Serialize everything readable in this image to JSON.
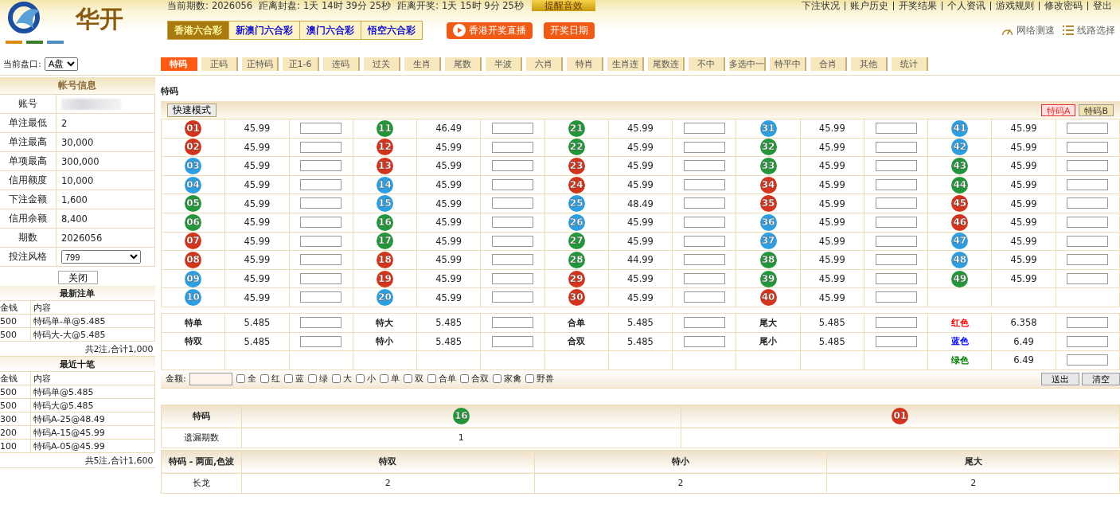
{
  "header": {
    "logo_text": "华开",
    "period_label": "当前期数:",
    "period": "2026056",
    "close_label": "距离封盘:",
    "close_time": "1天 14时 39分 25秒",
    "draw_label": "距离开奖:",
    "draw_time": "1天 15时 9分 25秒",
    "sound_button": "提醒音效",
    "user_links": [
      "下注状况",
      "账户历史",
      "开奖结果",
      "个人资讯",
      "游戏规则",
      "修改密码",
      "登出"
    ],
    "lottery_tabs": [
      {
        "label": "香港六合彩",
        "selected": true
      },
      {
        "label": "新澳门六合彩",
        "selected": false
      },
      {
        "label": "澳门六合彩",
        "selected": false
      },
      {
        "label": "悟空六合彩",
        "selected": false
      }
    ],
    "live_button": "香港开奖直播",
    "date_button": "开奖日期",
    "speed_test": "网络测速",
    "line_select": "线路选择"
  },
  "market": {
    "label": "当前盘口:",
    "value": "A盘"
  },
  "game_tabs": [
    {
      "label": "特码",
      "selected": true
    },
    {
      "label": "正码",
      "selected": false
    },
    {
      "label": "正特码",
      "selected": false
    },
    {
      "label": "正1-6",
      "selected": false
    },
    {
      "label": "连码",
      "selected": false
    },
    {
      "label": "过关",
      "selected": false
    },
    {
      "label": "生肖",
      "selected": false
    },
    {
      "label": "尾数",
      "selected": false
    },
    {
      "label": "半波",
      "selected": false
    },
    {
      "label": "六肖",
      "selected": false
    },
    {
      "label": "特肖",
      "selected": false
    },
    {
      "label": "生肖连",
      "selected": false
    },
    {
      "label": "尾数连",
      "selected": false
    },
    {
      "label": "不中",
      "selected": false
    },
    {
      "label": "多选中一",
      "selected": false
    },
    {
      "label": "特平中",
      "selected": false
    },
    {
      "label": "合肖",
      "selected": false
    },
    {
      "label": "其他",
      "selected": false
    },
    {
      "label": "统计",
      "selected": false
    }
  ],
  "account": {
    "title": "帐号信息",
    "rows": [
      {
        "label": "账号",
        "kind": "redacted"
      },
      {
        "label": "单注最低",
        "value": "2"
      },
      {
        "label": "单注最高",
        "value": "30,000"
      },
      {
        "label": "单项最高",
        "value": "300,000"
      },
      {
        "label": "信用额度",
        "value": "10,000"
      },
      {
        "label": "下注金额",
        "value": "1,600"
      },
      {
        "label": "信用余额",
        "value": "8,400"
      },
      {
        "label": "期数",
        "value": "2026056"
      },
      {
        "label": "投注风格",
        "kind": "select",
        "value": "799"
      }
    ],
    "close_button": "关闭"
  },
  "bet_lists": [
    {
      "title": "最新注单",
      "columns": [
        "金钱",
        "内容"
      ],
      "rows": [
        [
          "500",
          "特码单-单@5.485"
        ],
        [
          "500",
          "特码大-大@5.485"
        ]
      ],
      "summary": "共2注,合计1,000"
    },
    {
      "title": "最近十笔",
      "columns": [
        "金钱",
        "内容"
      ],
      "rows": [
        [
          "500",
          "特码单@5.485"
        ],
        [
          "500",
          "特码大@5.485"
        ],
        [
          "300",
          "特码A-25@48.49"
        ],
        [
          "200",
          "特码A-15@45.99"
        ],
        [
          "100",
          "特码A-05@45.99"
        ]
      ],
      "summary": "共5注,合计1,600"
    }
  ],
  "main": {
    "section_title": "特码",
    "quick_mode_button": "快速模式",
    "variant_tabs": [
      {
        "label": "特码A",
        "selected": true
      },
      {
        "label": "特码B",
        "selected": false
      }
    ],
    "numbers": [
      {
        "number": "01",
        "color": "#d2341c",
        "odds": "45.99"
      },
      {
        "number": "02",
        "color": "#d2341c",
        "odds": "45.99"
      },
      {
        "number": "03",
        "color": "#2d9fe0",
        "odds": "45.99"
      },
      {
        "number": "04",
        "color": "#2d9fe0",
        "odds": "45.99"
      },
      {
        "number": "05",
        "color": "#24963a",
        "odds": "45.99"
      },
      {
        "number": "06",
        "color": "#24963a",
        "odds": "45.99"
      },
      {
        "number": "07",
        "color": "#d2341c",
        "odds": "45.99"
      },
      {
        "number": "08",
        "color": "#d2341c",
        "odds": "45.99"
      },
      {
        "number": "09",
        "color": "#2d9fe0",
        "odds": "45.99"
      },
      {
        "number": "10",
        "color": "#2d9fe0",
        "odds": "45.99"
      },
      {
        "number": "11",
        "color": "#24963a",
        "odds": "46.49"
      },
      {
        "number": "12",
        "color": "#d2341c",
        "odds": "45.99"
      },
      {
        "number": "13",
        "color": "#d2341c",
        "odds": "45.99"
      },
      {
        "number": "14",
        "color": "#2d9fe0",
        "odds": "45.99"
      },
      {
        "number": "15",
        "color": "#2d9fe0",
        "odds": "45.99"
      },
      {
        "number": "16",
        "color": "#24963a",
        "odds": "45.99"
      },
      {
        "number": "17",
        "color": "#24963a",
        "odds": "45.99"
      },
      {
        "number": "18",
        "color": "#d2341c",
        "odds": "45.99"
      },
      {
        "number": "19",
        "color": "#d2341c",
        "odds": "45.99"
      },
      {
        "number": "20",
        "color": "#2d9fe0",
        "odds": "45.99"
      },
      {
        "number": "21",
        "color": "#24963a",
        "odds": "45.99"
      },
      {
        "number": "22",
        "color": "#24963a",
        "odds": "45.99"
      },
      {
        "number": "23",
        "color": "#d2341c",
        "odds": "45.99"
      },
      {
        "number": "24",
        "color": "#d2341c",
        "odds": "45.99"
      },
      {
        "number": "25",
        "color": "#2d9fe0",
        "odds": "48.49"
      },
      {
        "number": "26",
        "color": "#2d9fe0",
        "odds": "45.99"
      },
      {
        "number": "27",
        "color": "#24963a",
        "odds": "45.99"
      },
      {
        "number": "28",
        "color": "#24963a",
        "odds": "44.99"
      },
      {
        "number": "29",
        "color": "#d2341c",
        "odds": "45.99"
      },
      {
        "number": "30",
        "color": "#d2341c",
        "odds": "45.99"
      },
      {
        "number": "31",
        "color": "#2d9fe0",
        "odds": "45.99"
      },
      {
        "number": "32",
        "color": "#24963a",
        "odds": "45.99"
      },
      {
        "number": "33",
        "color": "#24963a",
        "odds": "45.99"
      },
      {
        "number": "34",
        "color": "#d2341c",
        "odds": "45.99"
      },
      {
        "number": "35",
        "color": "#d2341c",
        "odds": "45.99"
      },
      {
        "number": "36",
        "color": "#2d9fe0",
        "odds": "45.99"
      },
      {
        "number": "37",
        "color": "#2d9fe0",
        "odds": "45.99"
      },
      {
        "number": "38",
        "color": "#24963a",
        "odds": "45.99"
      },
      {
        "number": "39",
        "color": "#24963a",
        "odds": "45.99"
      },
      {
        "number": "40",
        "color": "#d2341c",
        "odds": "45.99"
      },
      {
        "number": "41",
        "color": "#2d9fe0",
        "odds": "45.99"
      },
      {
        "number": "42",
        "color": "#2d9fe0",
        "odds": "45.99"
      },
      {
        "number": "43",
        "color": "#24963a",
        "odds": "45.99"
      },
      {
        "number": "44",
        "color": "#24963a",
        "odds": "45.99"
      },
      {
        "number": "45",
        "color": "#d2341c",
        "odds": "45.99"
      },
      {
        "number": "46",
        "color": "#d2341c",
        "odds": "45.99"
      },
      {
        "number": "47",
        "color": "#2d9fe0",
        "odds": "45.99"
      },
      {
        "number": "48",
        "color": "#2d9fe0",
        "odds": "45.99"
      },
      {
        "number": "49",
        "color": "#24963a",
        "odds": "45.99"
      }
    ],
    "extra_bets": [
      [
        {
          "label": "特单",
          "odds": "5.485"
        },
        {
          "label": "特双",
          "odds": "5.485"
        }
      ],
      [
        {
          "label": "特大",
          "odds": "5.485"
        },
        {
          "label": "特小",
          "odds": "5.485"
        }
      ],
      [
        {
          "label": "合单",
          "odds": "5.485"
        },
        {
          "label": "合双",
          "odds": "5.485"
        }
      ],
      [
        {
          "label": "尾大",
          "odds": "5.485"
        },
        {
          "label": "尾小",
          "odds": "5.485"
        }
      ],
      [
        {
          "label": "红色",
          "odds": "6.358",
          "color": "#ff0000"
        },
        {
          "label": "蓝色",
          "odds": "6.49",
          "color": "#0000ff"
        },
        {
          "label": "绿色",
          "odds": "6.49",
          "color": "#008000"
        }
      ]
    ],
    "amount_label": "金额:",
    "quick_picks": [
      {
        "label": "全",
        "checked": false
      },
      {
        "label": "红",
        "checked": false
      },
      {
        "label": "蓝",
        "checked": false
      },
      {
        "label": "绿",
        "checked": false
      },
      {
        "label": "大",
        "checked": false
      },
      {
        "label": "小",
        "checked": false
      },
      {
        "label": "单",
        "checked": false
      },
      {
        "label": "双",
        "checked": false
      },
      {
        "label": "合单",
        "checked": false
      },
      {
        "label": "合双",
        "checked": false
      },
      {
        "label": "家禽",
        "checked": false
      },
      {
        "label": "野兽",
        "checked": false
      }
    ],
    "submit_button": "送出",
    "clear_button": "清空"
  },
  "stats": {
    "header": "特码",
    "results": [
      {
        "number": "16",
        "color": "#24963a"
      },
      {
        "number": "01",
        "color": "#d2341c"
      }
    ],
    "miss_label": "遗漏期数",
    "misses": [
      "1"
    ]
  },
  "streak": {
    "header": "特码 - 两面,色波",
    "columns": [
      "特双",
      "特小",
      "尾大"
    ],
    "row_label": "长龙",
    "values": [
      "2",
      "2",
      "2"
    ]
  }
}
